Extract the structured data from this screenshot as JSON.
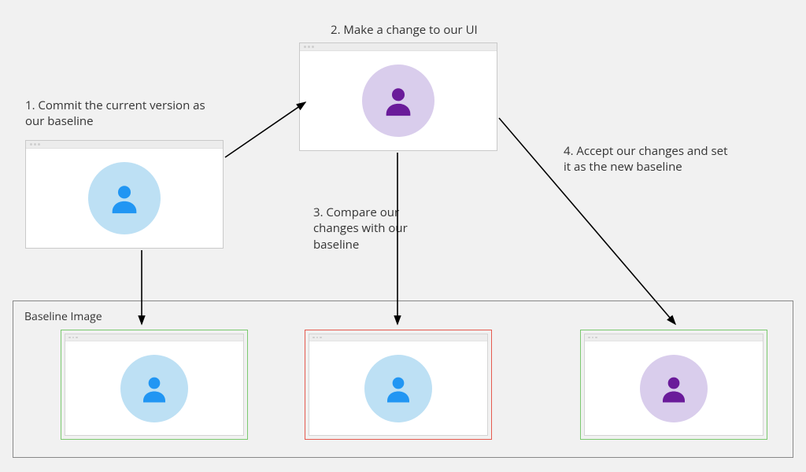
{
  "steps": {
    "s1": "1. Commit the current version as our baseline",
    "s2": "2. Make a change to our UI",
    "s3": "3. Compare our changes with our baseline",
    "s4": "4. Accept our changes and set it as the new baseline"
  },
  "baseline_label": "Baseline Image",
  "colors": {
    "blue_bg": "#bde0f4",
    "blue_fg": "#2196f3",
    "purple_bg": "#d9cdec",
    "purple_fg": "#6a1b9a",
    "green_border": "#7bc96f",
    "red_border": "#e55a4f"
  },
  "windows": {
    "top_left": {
      "avatar": "blue",
      "size": "large"
    },
    "top_right": {
      "avatar": "purple",
      "size": "large"
    },
    "bottom_1": {
      "avatar": "blue",
      "border": "green"
    },
    "bottom_2": {
      "avatar": "blue",
      "border": "red"
    },
    "bottom_3": {
      "avatar": "purple",
      "border": "green"
    }
  }
}
